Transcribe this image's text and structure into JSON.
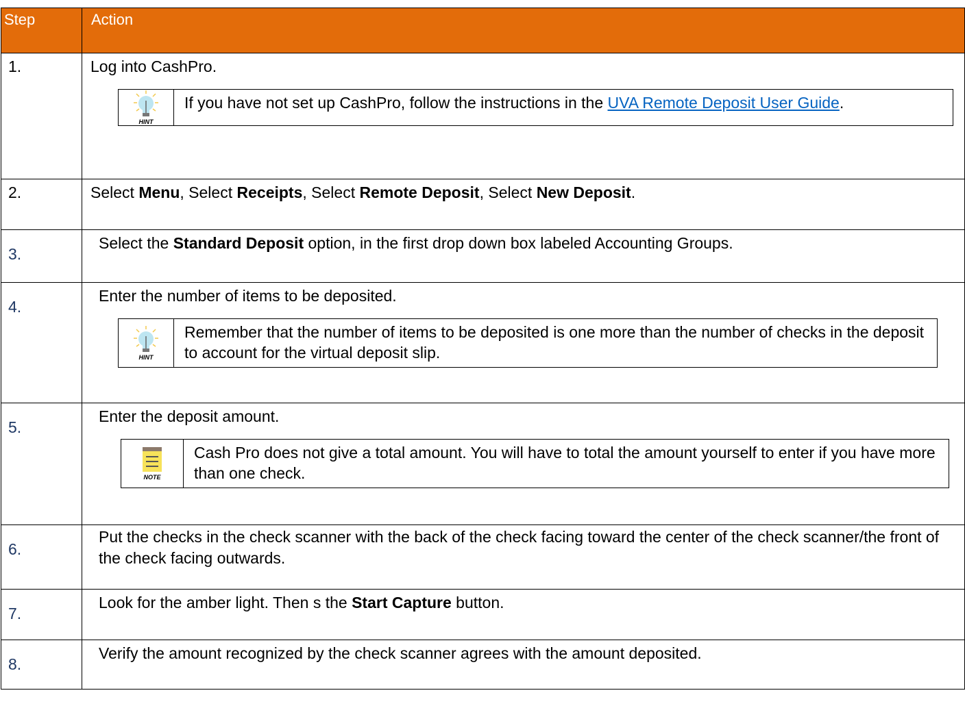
{
  "header": {
    "step": "Step",
    "action": "Action"
  },
  "rows": [
    {
      "num": "1.",
      "parts": [
        "Log into CashPro."
      ],
      "callout": {
        "icon": "hint-bulb-icon",
        "label": "HINT",
        "text": "If you have not set up CashPro, follow the instructions in the ",
        "link": "UVA Remote Deposit User Guide",
        "after": "."
      }
    },
    {
      "num": "2.",
      "p1": "Select ",
      "b1": "Menu",
      "p2": ", Select ",
      "b2": "Receipts",
      "p3": ", Select ",
      "b3": "Remote Deposit",
      "p4": ", Select ",
      "b4": "New Deposit",
      "p5": "."
    },
    {
      "num": "3.",
      "p1": "Select the ",
      "b1": "Standard Deposit",
      "p2": " option, in the first drop down box labeled Accounting Groups."
    },
    {
      "num": "4.",
      "text": "Enter the number of items to be deposited.",
      "callout": {
        "icon": "hint-bulb-icon",
        "label": "HINT",
        "text": "Remember that the number of items to be deposited is one more than the number of checks in the deposit to account for the virtual deposit slip."
      }
    },
    {
      "num": "5.",
      "text": "Enter the deposit amount.",
      "callout": {
        "icon": "note-pad-icon",
        "label": "NOTE",
        "text": "Cash Pro does not give a total amount.  You will have to total the amount yourself to enter if you have more than one check."
      }
    },
    {
      "num": "6.",
      "text": "Put the checks in the check scanner with the back of the check facing toward the center of the check scanner/the front of the check facing outwards."
    },
    {
      "num": "7.",
      "p1": "Look for the amber light.  Then s the ",
      "b1": "Start Capture",
      "p2": " button."
    },
    {
      "num": "8.",
      "text": "Verify the amount recognized by the check scanner agrees with the amount deposited."
    }
  ]
}
